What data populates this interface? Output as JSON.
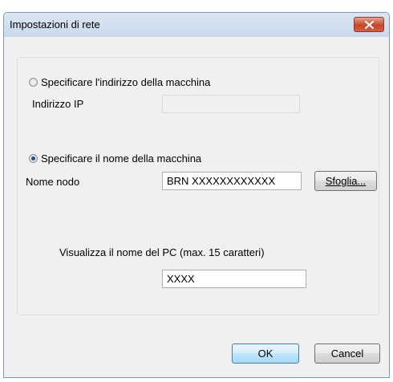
{
  "window": {
    "title": "Impostazioni di rete"
  },
  "options": {
    "address": {
      "label": "Specificare l'indirizzo della macchina",
      "selected": false,
      "field_label": "Indirizzo IP",
      "field_value": ""
    },
    "name": {
      "label": "Specificare il nome della macchina",
      "selected": true,
      "field_label": "Nome nodo",
      "field_value": "BRN XXXXXXXXXXXX",
      "browse_label": "Sfoglia..."
    }
  },
  "pc_name": {
    "label": "Visualizza il nome del PC (max. 15 caratteri)",
    "value": "XXXX"
  },
  "buttons": {
    "ok": "OK",
    "cancel": "Cancel"
  },
  "icons": {
    "close": "close-icon"
  },
  "colors": {
    "close_button": "#c7442b",
    "default_button_border": "#3c7fb1",
    "radio_dot": "#1c4f8c"
  }
}
